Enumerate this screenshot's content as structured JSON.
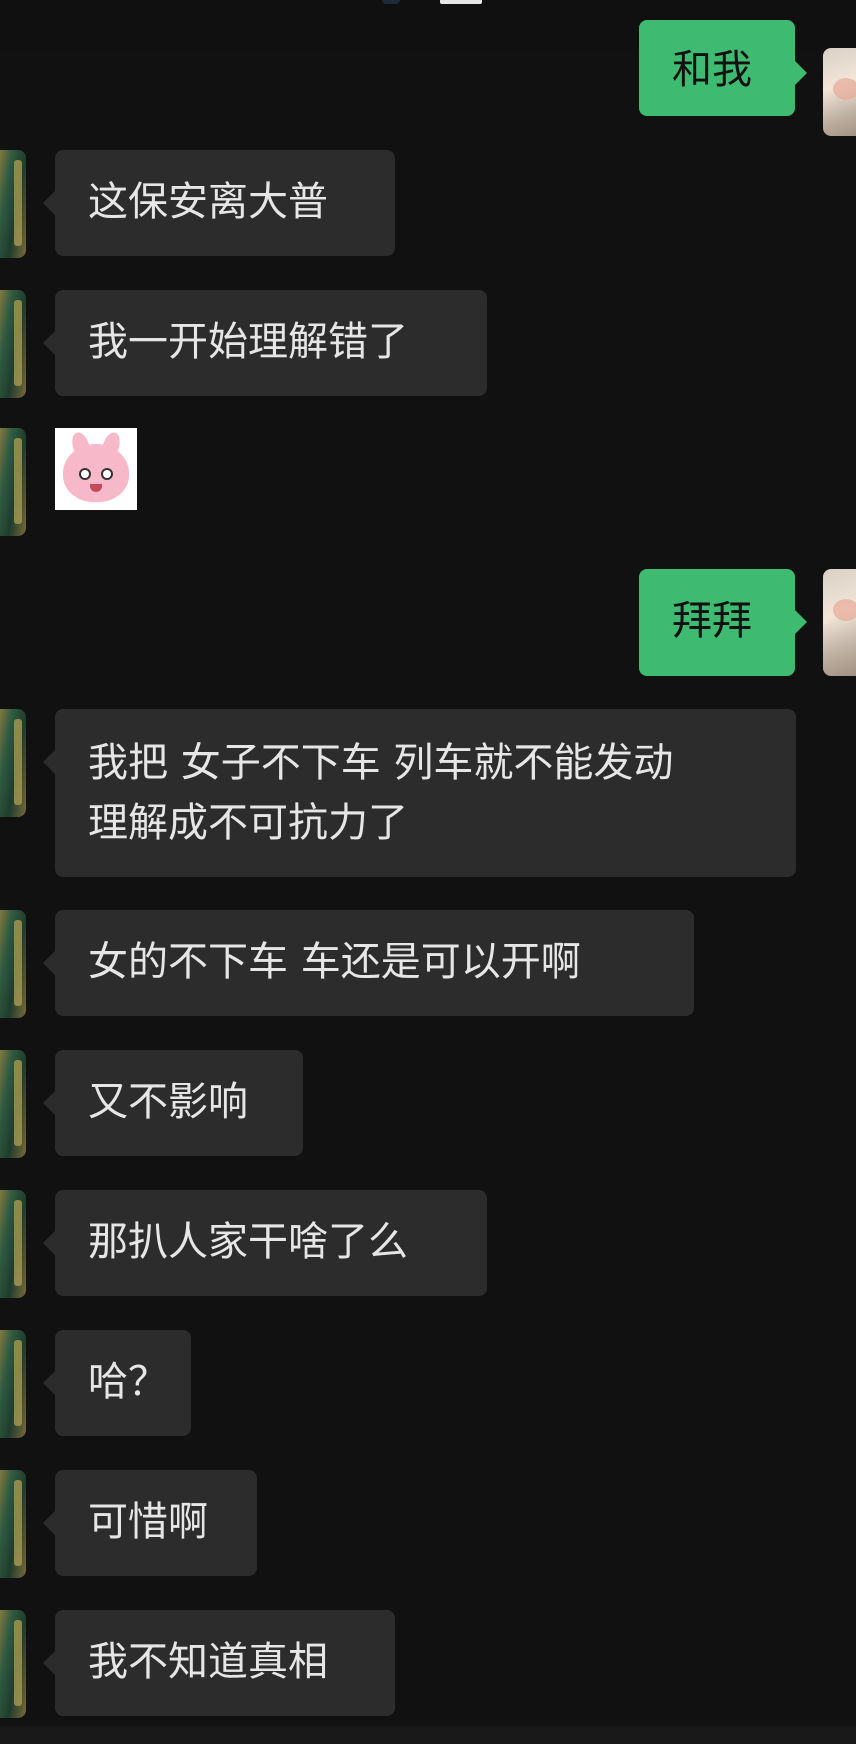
{
  "messages": [
    {
      "side": "out",
      "text": "和我"
    },
    {
      "side": "in",
      "text": "这保安离大普"
    },
    {
      "side": "in",
      "text": "我一开始理解错了"
    },
    {
      "side": "in",
      "type": "sticker",
      "sticker": "pink-bunny-face-icon"
    },
    {
      "side": "out",
      "text": "拜拜"
    },
    {
      "side": "in",
      "lines": [
        "我把 女子不下车 列车就不能发动",
        "理解成不可抗力了"
      ]
    },
    {
      "side": "in",
      "text": "女的不下车  车还是可以开啊"
    },
    {
      "side": "in",
      "text": "又不影响"
    },
    {
      "side": "in",
      "text": "那扒人家干啥了么"
    },
    {
      "side": "in",
      "text": "哈？"
    },
    {
      "side": "in",
      "text": "可惜啊"
    },
    {
      "side": "in",
      "text": "我不知道真相"
    }
  ],
  "colors": {
    "background": "#111111",
    "incoming_bubble": "#2c2c2c",
    "outgoing_bubble": "#3ebb71",
    "incoming_text": "#e6e6e6",
    "outgoing_text": "#111111"
  }
}
